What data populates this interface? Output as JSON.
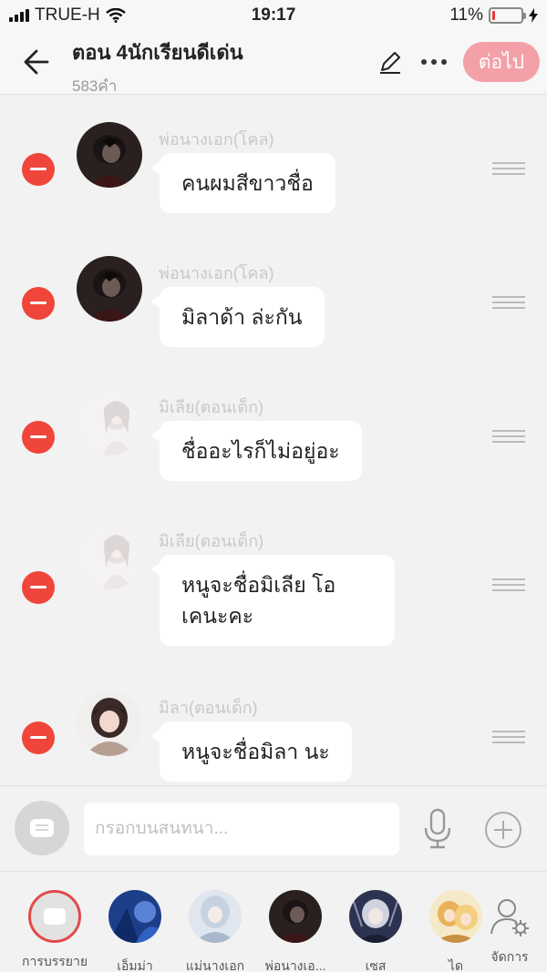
{
  "status_bar": {
    "carrier": "TRUE-H",
    "time": "19:17",
    "battery": "11%",
    "battery_level": 0.11
  },
  "header": {
    "title": "ตอน 4นักเรียนดีเด่น",
    "subtitle": "583คำ",
    "next_label": "ต่อไป"
  },
  "messages": [
    {
      "speaker": "พ่อนางเอก(โคล)",
      "text": "คนผมสีขาวชื่อ"
    },
    {
      "speaker": "พ่อนางเอก(โคล)",
      "text": "มิลาด้า ล่ะกัน"
    },
    {
      "speaker": "มิเลีย(ตอนเด็ก)",
      "text": "ชื่ออะไรก็ไม่อยู่อะ"
    },
    {
      "speaker": "มิเลีย(ตอนเด็ก)",
      "text": "หนูจะชื่อมิเลีย โอ\nเคนะคะ"
    },
    {
      "speaker": "มิลา(ตอนเด็ก)",
      "text": "หนูจะชื่อมิลา นะ"
    }
  ],
  "composer": {
    "placeholder": "กรอกบนสนทนา..."
  },
  "characters": [
    {
      "name": "การบรรยาย"
    },
    {
      "name": "เอ็มม่า"
    },
    {
      "name": "แม่นางเอก"
    },
    {
      "name": "พ่อนางเอ..."
    },
    {
      "name": "เซส"
    },
    {
      "name": "ได"
    },
    {
      "name": "จัดการ"
    }
  ],
  "colors": {
    "accent": "#f0453a",
    "next_button": "#f4a0a8",
    "background": "#f2f2f2"
  }
}
